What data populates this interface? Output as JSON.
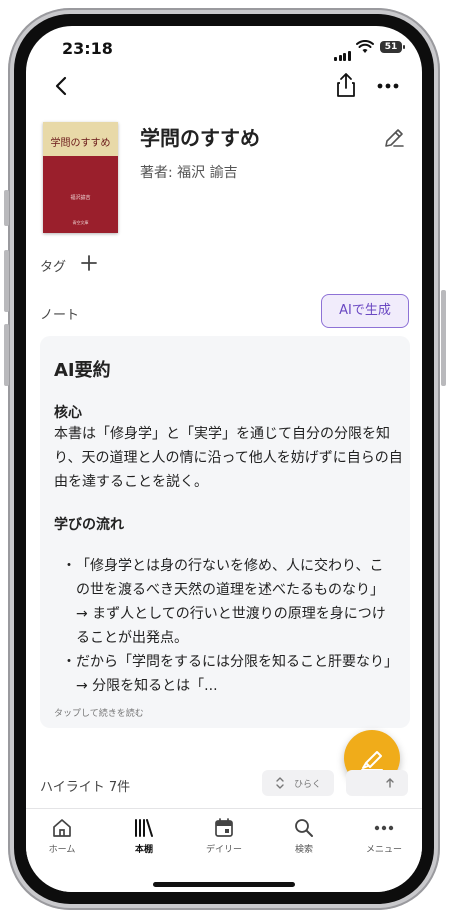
{
  "status": {
    "time": "23:18",
    "battery": "51"
  },
  "book": {
    "title": "学問のすすめ",
    "author": "著者: 福沢 諭吉",
    "cover": {
      "title": "学問のすすめ",
      "author": "福沢諭吉",
      "publisher": "青空文庫"
    }
  },
  "tags": {
    "label": "タグ"
  },
  "notes": {
    "label": "ノート",
    "ai_button": "AIで生成"
  },
  "summary": {
    "title": "AI要約",
    "core_heading": "核心",
    "core_text": "本書は「修身学」と「実学」を通じて自分の分限を知り、天の道理と人の情に沿って他人を妨げずに自らの自由を達することを説く。",
    "flow_heading": "学びの流れ",
    "bullets": [
      "「修身学とは身の行ないを修め、人に交わり、この世を渡るべき天然の道理を述べたるものなり」→ まず人としての行いと世渡りの原理を身につけることが出発点。",
      "だから「学問をするには分限を知ること肝要なり」→ 分限を知るとは「..."
    ],
    "read_more": "タップして続きを読む"
  },
  "highlights": {
    "label": "ハイライト 7件",
    "expand_label": "ひらく"
  },
  "tabbar": {
    "items": [
      {
        "label": "ホーム",
        "icon": "home-icon"
      },
      {
        "label": "本棚",
        "icon": "bookshelf-icon",
        "active": true
      },
      {
        "label": "デイリー",
        "icon": "calendar-icon"
      },
      {
        "label": "検索",
        "icon": "search-icon"
      },
      {
        "label": "メニュー",
        "icon": "more-icon"
      }
    ]
  },
  "colors": {
    "accent_purple": "#6a48c2",
    "fab": "#f0ac1a",
    "cover_red": "#9a1f2c"
  }
}
